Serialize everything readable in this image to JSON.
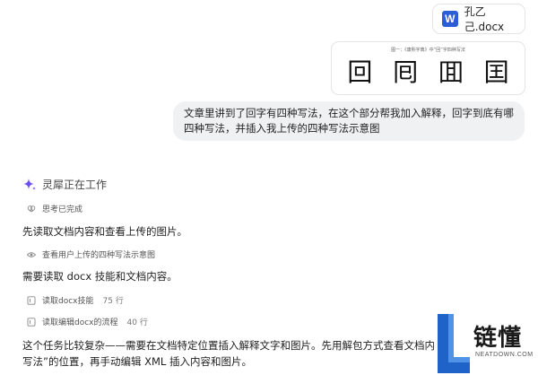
{
  "attachment": {
    "file_name": "孔乙己.docx",
    "file_icon_letter": "W",
    "image_caption": "图一：《康熙字典》中“回”字四种写法",
    "image_chars": [
      "回",
      "囘",
      "囬",
      "囯"
    ]
  },
  "user_message": {
    "line1": "文章里讲到了回字有四种写法，在这个部分帮我加入解释，回字到底有哪",
    "line2": "四种写法，并插入我上传的四种写法示意图"
  },
  "assistant": {
    "status": "灵犀正在工作",
    "think_done": "思考已完成",
    "para1": "先读取文档内容和查看上传的图片。",
    "step_view_image": "查看用户上传的四种写法示意图",
    "para2": "需要读取 docx 技能和文档内容。",
    "steps": [
      {
        "label": "读取docx技能",
        "count": "75 行"
      },
      {
        "label": "读取编辑docx的流程",
        "count": "40 行"
      }
    ],
    "para3_line1": "这个任务比较复杂——需要在文档特定位置插入解释文字和图片。先用解包方式查看文档内",
    "para3_line2": "写法”的位置，再手动编辑 XML 插入内容和图片。"
  },
  "watermark": {
    "brand": "链懂",
    "domain": "NEATDOWN.COM"
  },
  "colors": {
    "accent_purple": "#6b4df0",
    "word_blue": "#2b5ed6",
    "bubble_bg": "#f0f1f3"
  }
}
